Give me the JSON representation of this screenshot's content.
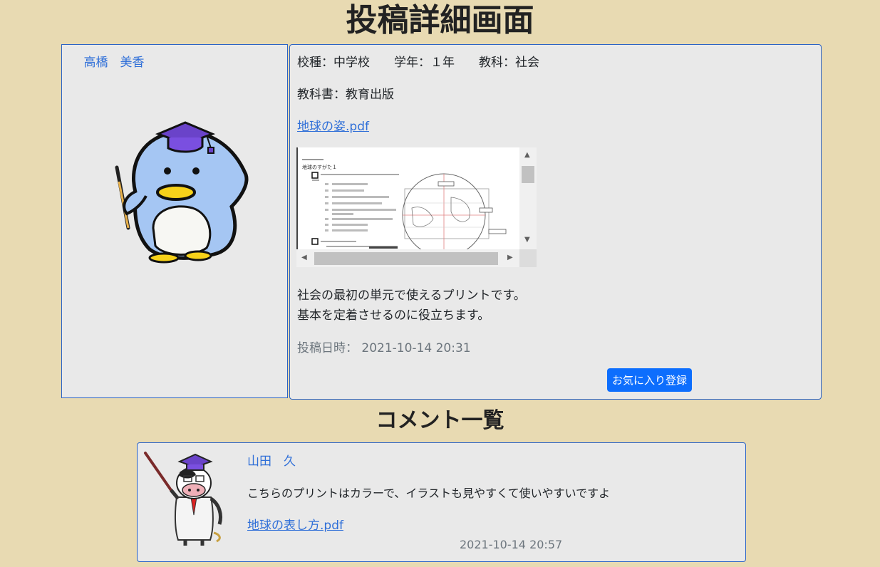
{
  "page_title": "投稿詳細画面",
  "author": {
    "name": "高橋　美香",
    "avatar": "penguin-teacher-avatar"
  },
  "post": {
    "school_type_label": "校種：中学校",
    "grade_label": "学年：１年",
    "subject_label": "教科：社会",
    "textbook_label": "教科書：教育出版",
    "attachment_name": "地球の姿.pdf",
    "description_line1": "社会の最初の単元で使えるプリントです。",
    "description_line2": "基本を定着させるのに役立ちます。",
    "posted_at_label": "投稿日時：",
    "posted_at": "2021-10-14 20:31",
    "favorite_button": "お気に入り登録",
    "preview": {
      "heading": "地球のすがた１"
    }
  },
  "comments_title": "コメント一覧",
  "comments": [
    {
      "name": "山田　久",
      "avatar": "cow-teacher-avatar",
      "text": "こちらのプリントはカラーで、イラストも見やすくて使いやすいですよ",
      "attachment_name": "地球の表し方.pdf",
      "date": "2021-10-14 20:57"
    }
  ],
  "colors": {
    "background": "#e8dab2",
    "card": "#e9e9e9",
    "border": "#2b63c6",
    "link": "#2f6fd8",
    "button": "#0d6efd"
  }
}
